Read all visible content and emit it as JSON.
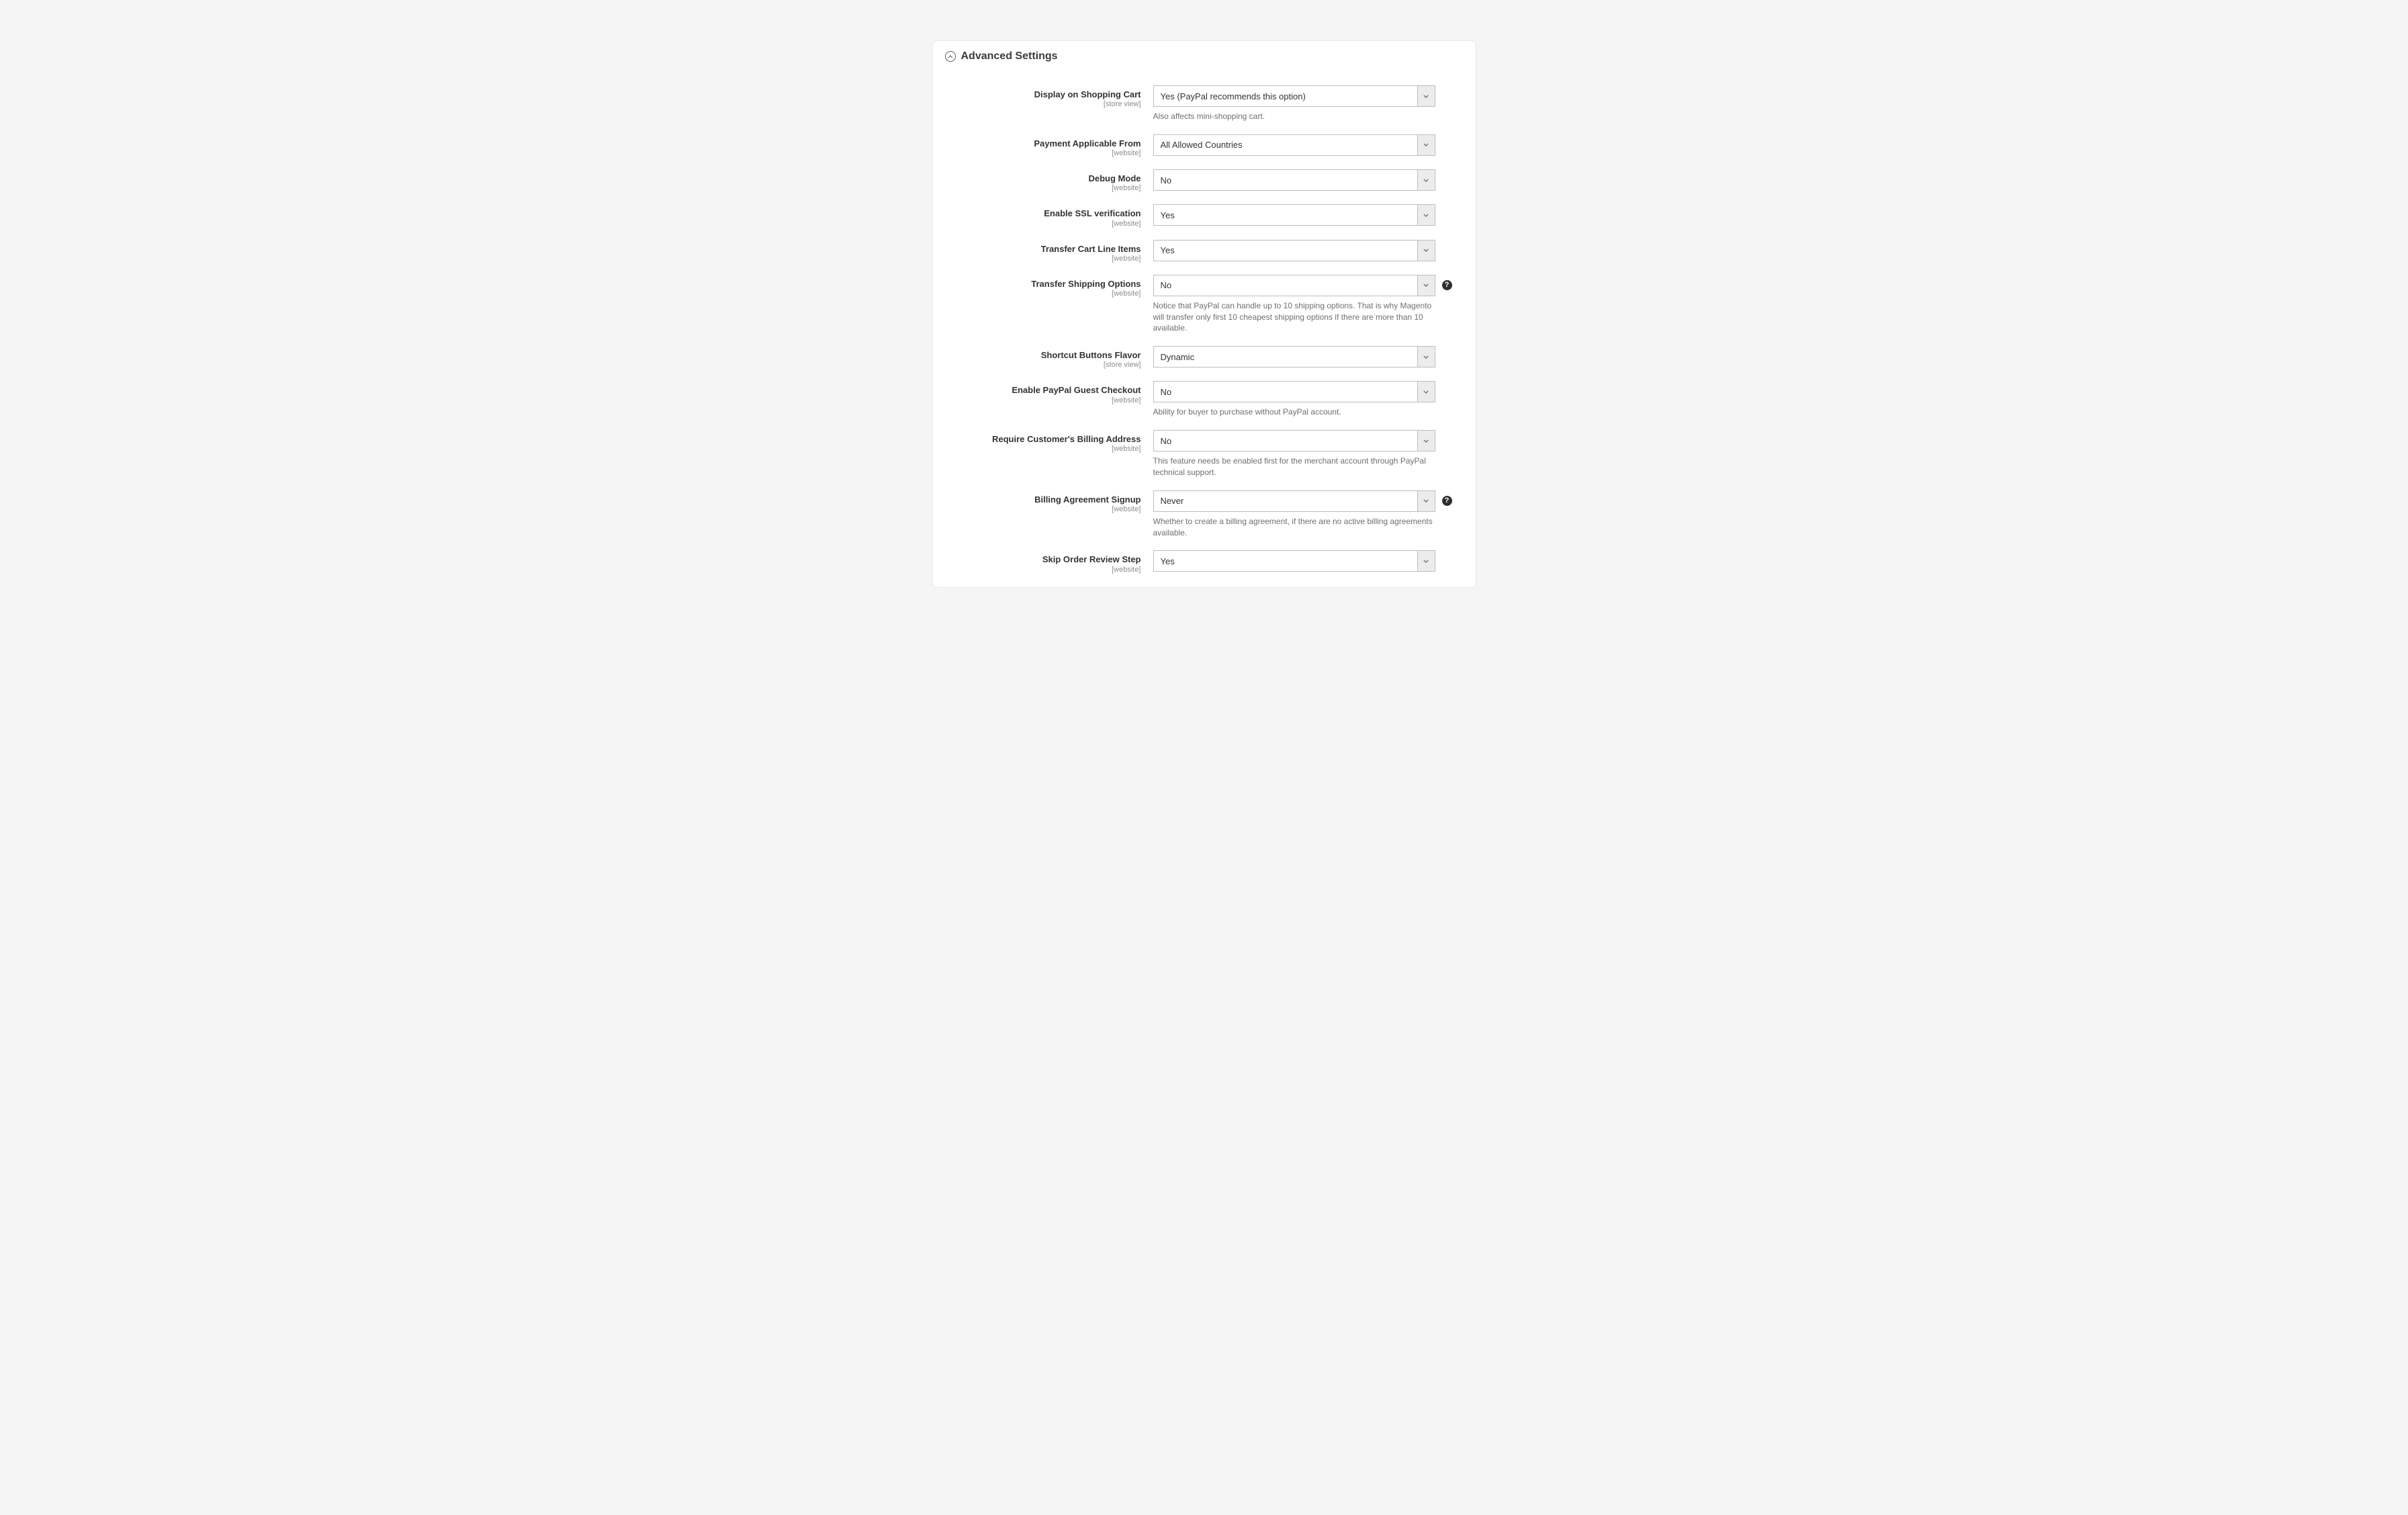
{
  "section": {
    "title": "Advanced Settings"
  },
  "fields": {
    "display_cart": {
      "label": "Display on Shopping Cart",
      "scope": "[store view]",
      "value": "Yes (PayPal recommends this option)",
      "note": "Also affects mini-shopping cart."
    },
    "payment_applicable": {
      "label": "Payment Applicable From",
      "scope": "[website]",
      "value": "All Allowed Countries"
    },
    "debug_mode": {
      "label": "Debug Mode",
      "scope": "[website]",
      "value": "No"
    },
    "ssl_verification": {
      "label": "Enable SSL verification",
      "scope": "[website]",
      "value": "Yes"
    },
    "transfer_cart_items": {
      "label": "Transfer Cart Line Items",
      "scope": "[website]",
      "value": "Yes"
    },
    "transfer_shipping": {
      "label": "Transfer Shipping Options",
      "scope": "[website]",
      "value": "No",
      "note": "Notice that PayPal can handle up to 10 shipping options. That is why Magento will transfer only first 10 cheapest shipping options if there are more than 10 available."
    },
    "shortcut_flavor": {
      "label": "Shortcut Buttons Flavor",
      "scope": "[store view]",
      "value": "Dynamic"
    },
    "guest_checkout": {
      "label": "Enable PayPal Guest Checkout",
      "scope": "[website]",
      "value": "No",
      "note": "Ability for buyer to purchase without PayPal account."
    },
    "billing_address": {
      "label": "Require Customer's Billing Address",
      "scope": "[website]",
      "value": "No",
      "note": "This feature needs be enabled first for the merchant account through PayPal technical support."
    },
    "billing_agreement": {
      "label": "Billing Agreement Signup",
      "scope": "[website]",
      "value": "Never",
      "note": "Whether to create a billing agreement, if there are no active billing agreements available."
    },
    "skip_review": {
      "label": "Skip Order Review Step",
      "scope": "[website]",
      "value": "Yes"
    }
  }
}
